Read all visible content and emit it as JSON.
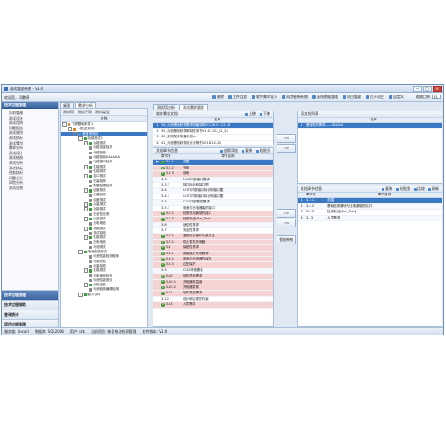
{
  "window": {
    "title": "测试管理系统 - V3.0",
    "controls": [
      "—",
      "□",
      "×"
    ]
  },
  "toolbar": {
    "welcome": "欢迎您，邓鹏锦",
    "items": [
      "删除",
      "文件比较",
      "软件需求导入",
      "同步更新系统",
      "基线数据管理",
      "项目管理",
      "打开项目",
      "自定义"
    ],
    "zoom_label": "缩放比例",
    "zoom_value": "15"
  },
  "leftnav": {
    "header": "技术过程管理",
    "items": [
      "识别管理",
      "测试设计",
      "测试用例",
      "问题报告",
      "测试规则",
      "测试执行",
      "测试策划",
      "需求分析",
      "测试设计",
      "测试结构",
      "测试分析",
      "测试执行",
      "任务执行",
      "问题分析",
      "风险分析",
      "测试总结"
    ],
    "footer": [
      "技术过程管理",
      "技术过程辅助",
      "查询统计",
      "项目过程管理"
    ]
  },
  "tabs": [
    "桌面",
    "需求分析"
  ],
  "tree": {
    "toolbar": [
      "测试项",
      "测试子项",
      "测试类型"
    ],
    "header": "名称",
    "nodes": [
      {
        "label": "飞机基础软件1",
        "level": 0
      },
      {
        "label": "1.发送(双向)",
        "level": 1
      },
      {
        "label": "配置项测试",
        "level": 2
      },
      {
        "label": "功能测试1",
        "level": 3
      },
      {
        "label": "功能测试",
        "level": 4
      },
      {
        "label": "电缆连接检测",
        "level": 5
      },
      {
        "label": "电缆检测",
        "level": 5
      },
      {
        "label": "电缆检测AAAAAA",
        "level": 5
      },
      {
        "label": "电缆接口检测",
        "level": 5
      },
      {
        "label": "性能测试",
        "level": 4
      },
      {
        "label": "性能测试",
        "level": 5
      },
      {
        "label": "接口测试",
        "level": 4
      },
      {
        "label": "安装检测",
        "level": 5
      },
      {
        "label": "数据处理检测",
        "level": 5
      },
      {
        "label": "强度测试",
        "level": 4
      },
      {
        "label": "安装检测",
        "level": 5
      },
      {
        "label": "强度测试",
        "level": 5
      },
      {
        "label": "余量测试",
        "level": 4
      },
      {
        "label": "功能测试",
        "level": 4
      },
      {
        "label": "安全性检测",
        "level": 5
      },
      {
        "label": "余量测试",
        "level": 4
      },
      {
        "label": "充电电池",
        "level": 5
      },
      {
        "label": "功能测试",
        "level": 4
      },
      {
        "label": "测试检测",
        "level": 5
      },
      {
        "label": "性能测试",
        "level": 4
      },
      {
        "label": "充电电池",
        "level": 5
      },
      {
        "label": "电池测试",
        "level": 5
      },
      {
        "label": "电池性能测试",
        "level": 3
      },
      {
        "label": "电池性能检测程序",
        "level": 5
      },
      {
        "label": "电源充电",
        "level": 5
      },
      {
        "label": "电量检测",
        "level": 5
      },
      {
        "label": "性能测试",
        "level": 4
      },
      {
        "label": "充电电池检测",
        "level": 5
      },
      {
        "label": "电池性能测试",
        "level": 5
      },
      {
        "label": "代码走查",
        "level": 4
      },
      {
        "label": "电池检测编辑检测",
        "level": 5
      },
      {
        "label": "嵌入软件",
        "level": 3
      }
    ]
  },
  "main": {
    "tabs": [
      "测试项分析",
      "测试需求跟踪"
    ],
    "req_list": {
      "title": "软件需求文档",
      "buttons": [
        "上移",
        "下移"
      ],
      "header": "名称",
      "rows": [
        {
          "num": "1",
          "name": "36_电池基础软件需求规格说明V1.08.01.12.18",
          "state": "sel"
        },
        {
          "num": "2",
          "name": "35_电池基础软件研制任务书V1.01.01_12_24",
          "state": ""
        },
        {
          "num": "3",
          "name": "42_软件配件测量手册cn",
          "state": ""
        },
        {
          "num": "4",
          "name": "41_电池基础软件设计说明书2018-12-23",
          "state": ""
        }
      ]
    },
    "req_detail": {
      "title": "文档章节信息",
      "buttons": [
        "追踪添加",
        "复制",
        "粘贴到"
      ],
      "headers": [
        "章节号",
        "章节名称"
      ],
      "rows": [
        {
          "badge": "2",
          "code": "3.2.1",
          "name": "范围",
          "state": "sel"
        },
        {
          "badge": "2",
          "code": "3.2.2",
          "name": "充电",
          "state": "hl"
        },
        {
          "badge": "2",
          "code": "3.2.3",
          "name": "放电",
          "state": "hl"
        },
        {
          "badge": "",
          "code": "3.3",
          "name": "CSCI内部接口需求",
          "state": ""
        },
        {
          "badge": "",
          "code": "3.3.1",
          "name": "接口标识和接口图",
          "state": ""
        },
        {
          "badge": "",
          "code": "3.4",
          "name": "UEST内部接口标识和接口图",
          "state": ""
        },
        {
          "badge": "",
          "code": "3.4.1",
          "name": "UEST内部接口标识和接口图",
          "state": ""
        },
        {
          "badge": "",
          "code": "3.5",
          "name": "CSCI内部数据需求",
          "state": ""
        },
        {
          "badge": "",
          "code": "3.5.1",
          "name": "电池与充电器端的接口",
          "state": ""
        },
        {
          "badge": "2",
          "code": "3.5.2",
          "name": "检测充电器端的接口",
          "state": "hl"
        },
        {
          "badge": "2",
          "code": "3.5.3",
          "name": "检测电池[Bat_Test]",
          "state": "hl"
        },
        {
          "badge": "",
          "code": "3.6",
          "name": "适应性需求",
          "state": ""
        },
        {
          "badge": "",
          "code": "3.7",
          "name": "安全性需求",
          "state": ""
        },
        {
          "badge": "2",
          "code": "3.7.1",
          "name": "温度检测保护功能安全",
          "state": "hl"
        },
        {
          "badge": "2",
          "code": "3.7.2",
          "name": "防止发热充电器",
          "state": "hl"
        },
        {
          "badge": "2",
          "code": "3.8",
          "name": "保密性需求",
          "state": "hl"
        },
        {
          "badge": "2",
          "code": "3.8.1",
          "name": "数据保护充电器等",
          "state": "hl"
        },
        {
          "badge": "2",
          "code": "3.8.2",
          "name": "电池与充电器的保护",
          "state": "hl"
        },
        {
          "badge": "2",
          "code": "3.8.3",
          "name": "过压保护",
          "state": "hl"
        },
        {
          "badge": "",
          "code": "3.9",
          "name": "CSCI环境需求",
          "state": ""
        },
        {
          "badge": "2",
          "code": "3.10",
          "name": "软件质量需求",
          "state": "hl"
        },
        {
          "badge": "2",
          "code": "3.10.1",
          "name": "充电器时温度",
          "state": "hl"
        },
        {
          "badge": "2",
          "code": "3.10.2",
          "name": "充电器异常",
          "state": "hl"
        },
        {
          "badge": "2",
          "code": "3.11",
          "name": "软件质量需求",
          "state": "hl"
        },
        {
          "badge": "",
          "code": "3.12",
          "name": "设计和实现的约束",
          "state": ""
        },
        {
          "badge": "2",
          "code": "3.13",
          "name": "人员需求",
          "state": "hl"
        }
      ]
    },
    "test_list": {
      "title": "项文档列表",
      "header": "名称",
      "rows": [
        {
          "num": "1",
          "name": "基础软件需求——AAAAA",
          "state": "sel"
        }
      ]
    },
    "test_detail": {
      "title": "文档章节信息",
      "buttons": [
        "复制",
        "粘贴到",
        "比较",
        "刷新"
      ],
      "headers": [
        "章节号",
        "章节名称"
      ],
      "rows": [
        {
          "num": "1",
          "code": "3.2.1",
          "name": "范围",
          "state": "sel"
        },
        {
          "num": "2",
          "code": "3.2.2",
          "name": "基础检测模块与充电器端的接口",
          "state": ""
        },
        {
          "num": "3",
          "code": "3.2.3",
          "name": "检测电池[Bat_Test]",
          "state": ""
        },
        {
          "num": "4",
          "code": "3.13",
          "name": "人员需求",
          "state": ""
        }
      ]
    },
    "arrows": {
      "add": ">>",
      "remove": "<<",
      "trace": "智能映射"
    }
  },
  "status": [
    "服务器: (local)",
    "数据库: SQL2008",
    "用户: lzk",
    "当前项目: 新型电池检测管理",
    "软件版本: V3.0"
  ]
}
